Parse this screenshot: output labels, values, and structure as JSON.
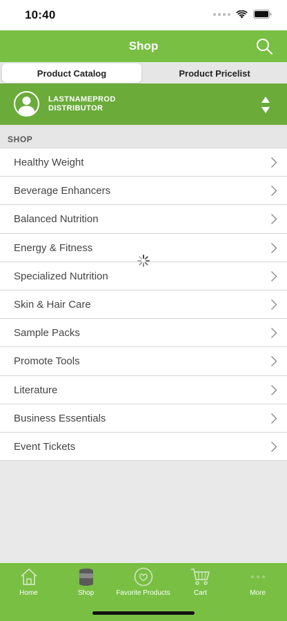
{
  "status_bar": {
    "time": "10:40"
  },
  "nav": {
    "title": "Shop"
  },
  "segments": {
    "active": "Product Catalog",
    "inactive": "Product Pricelist"
  },
  "distributor": {
    "name": "LASTNAMEPROD",
    "role": "DISTRIBUTOR"
  },
  "section": {
    "title": "SHOP"
  },
  "categories": [
    "Healthy Weight",
    "Beverage Enhancers",
    "Balanced Nutrition",
    "Energy & Fitness",
    "Specialized Nutrition",
    "Skin & Hair Care",
    "Sample Packs",
    "Promote Tools",
    "Literature",
    "Business Essentials",
    "Event Tickets"
  ],
  "tabs": {
    "home": "Home",
    "shop": "Shop",
    "favorites": "Favorite Products",
    "cart": "Cart",
    "more": "More"
  },
  "colors": {
    "brand_green": "#78bf43",
    "distributor_green": "#6aab3a"
  },
  "icons": [
    "search-icon",
    "user-avatar-icon",
    "sort-arrows-icon",
    "chevron-right-icon",
    "loading-spinner-icon",
    "home-icon",
    "shop-icon",
    "heart-icon",
    "cart-icon",
    "more-icon"
  ]
}
